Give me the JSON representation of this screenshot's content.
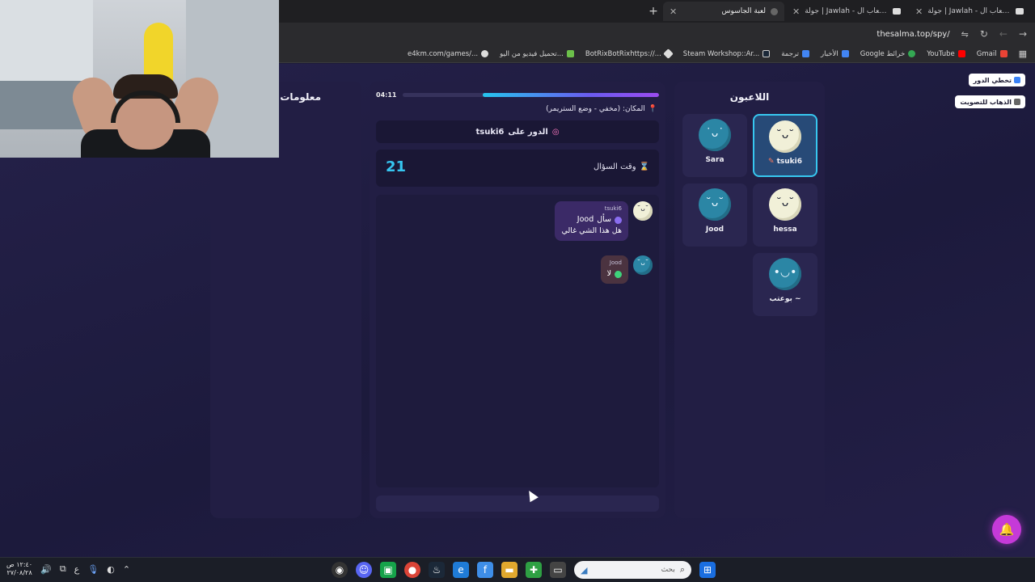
{
  "browser": {
    "tabs": [
      {
        "label": "جولة | Jawlah - منصة الألعاب ال...",
        "active": false
      },
      {
        "label": "جولة | Jawlah - منصة الألعاب ال...",
        "active": false
      },
      {
        "label": "لعبة الجاسوس",
        "active": true
      }
    ],
    "new_tab": "+",
    "url": "thesalma.top/spy/",
    "bookmarks": [
      {
        "label": "Gmail",
        "color": "#ea4335"
      },
      {
        "label": "YouTube",
        "color": "#ff0000"
      },
      {
        "label": "Google خرائط",
        "color": "#34a853"
      },
      {
        "label": "الأخبار",
        "color": "#4285f4"
      },
      {
        "label": "ترجمة",
        "color": "#4285f4"
      },
      {
        "label": "Steam Workshop::Ar...",
        "color": "#dddddd"
      },
      {
        "label": "BotRixBotRixhttps://...",
        "color": "#dddddd"
      },
      {
        "label": "تحميل فيديو من اليو...",
        "color": "#6cc04a"
      },
      {
        "label": "e4km.com/games/...",
        "color": "#dddddd"
      }
    ]
  },
  "game": {
    "timer": "04:11",
    "timer_fraction": 0.69,
    "location_label": "المكان: (مخفي - وضع الستريمر)",
    "turn_label": "الدور على",
    "turn_player": "tsuki6",
    "question_time_label": "وقت السؤال",
    "question_time_value": "21",
    "messages": [
      {
        "sender": "tsuki6",
        "line1_prefix": "سأل",
        "line1_target": "Jood",
        "line2": "هل هذا الشي غالي",
        "bubble": "purple",
        "avatar": "light"
      },
      {
        "sender": "Jood",
        "line1": "لا",
        "bubble": "brown",
        "avatar": "blue"
      }
    ]
  },
  "players_panel": {
    "title": "اللاعبون",
    "players": [
      {
        "name": "tsuki6",
        "active": true,
        "avatar": "light",
        "face": "˘ᴗ˘"
      },
      {
        "name": "Sara",
        "active": false,
        "avatar": "blue",
        "face": "˙ᴗ˙"
      },
      {
        "name": "hessa",
        "active": false,
        "avatar": "light",
        "face": "˘ᴗ˘"
      },
      {
        "name": "Jood",
        "active": false,
        "avatar": "blue",
        "face": "˘ᴗ˘"
      },
      {
        "name": "بوعتب ~",
        "active": false,
        "avatar": "blue",
        "face": "•◡•"
      }
    ]
  },
  "info_panel": {
    "title": "معلومات"
  },
  "side_buttons": {
    "skip_turn": "تخطي الدور",
    "go_vote": "الذهاب للتصويت"
  },
  "taskbar": {
    "search_placeholder": "بحث",
    "time": "١٢:٤٠ ص",
    "date": "٢٧/٠٨/٢٨",
    "lang": "ع"
  }
}
